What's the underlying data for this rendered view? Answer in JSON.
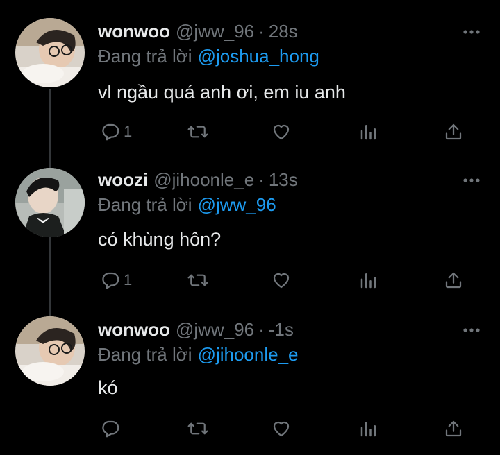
{
  "tweets": [
    {
      "username": "wonwoo",
      "handle": "@jww_96",
      "separator": "·",
      "time": "28s",
      "replying_prefix": "Đang trả lời",
      "replying_to": "@joshua_hong",
      "text": "vl ngầu quá anh ơi, em iu anh",
      "reply_count": "1"
    },
    {
      "username": "woozi",
      "handle": "@jihoonle_e",
      "separator": "·",
      "time": "13s",
      "replying_prefix": "Đang trả lời",
      "replying_to": "@jww_96",
      "text": "có khùng hôn?",
      "reply_count": "1"
    },
    {
      "username": "wonwoo",
      "handle": "@jww_96",
      "separator": "·",
      "time": "-1s",
      "replying_prefix": "Đang trả lời",
      "replying_to": "@jihoonle_e",
      "text": "kó",
      "reply_count": ""
    }
  ],
  "icons": {
    "reply": "reply-icon",
    "retweet": "retweet-icon",
    "like": "heart-icon",
    "views": "views-icon",
    "share": "share-icon",
    "more": "more-icon"
  },
  "colors": {
    "background": "#000000",
    "text": "#e7e9ea",
    "muted": "#71767b",
    "mention": "#1d9bf0",
    "thread_line": "#333639"
  }
}
